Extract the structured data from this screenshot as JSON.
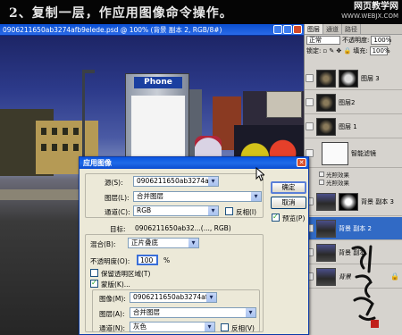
{
  "banner": {
    "instruction": "2、复制一层，作应用图像命令操作。",
    "site_name": "网页教学网",
    "site_url": "WWW.WEBJX.COM"
  },
  "document": {
    "title": "0906211650ab3274afb9elede.psd @ 100% (背景 副本 2, RGB/8#)",
    "booth_sign": "Phone"
  },
  "layers_panel": {
    "tabs": [
      "图层",
      "通道",
      "路径"
    ],
    "blend_mode": "正常",
    "opacity_label": "不透明度:",
    "opacity_value": "100%",
    "lock_label": "锁定:",
    "fill_label": "填充:",
    "fill_value": "100%",
    "layers": [
      {
        "name": "图层 3",
        "visible": true,
        "active": false
      },
      {
        "name": "图层2",
        "visible": true,
        "active": false
      },
      {
        "name": "图层 1",
        "visible": true,
        "active": false
      },
      {
        "name": "智能滤镜",
        "visible": true,
        "active": false
      },
      {
        "name": "背景 副本 3",
        "visible": true,
        "active": false
      },
      {
        "name": "背景 副本 2",
        "visible": true,
        "active": true
      },
      {
        "name": "背景 副本",
        "visible": true,
        "active": false
      },
      {
        "name": "背景",
        "visible": true,
        "active": false
      }
    ],
    "effects": [
      "光照效果",
      "光照效果"
    ]
  },
  "dialog": {
    "title": "应用图像",
    "source_label": "源(S):",
    "source_value": "0906211650ab3274afb9...",
    "layer_label": "图层(L):",
    "layer_value": "合并图层",
    "channel_label": "通道(C):",
    "channel_value": "RGB",
    "invert_label": "反相(I)",
    "target_label": "目标:",
    "target_value": "0906211650ab32...(..., RGB)",
    "blending_label": "混合(B):",
    "blending_value": "正片叠底",
    "opacity_label": "不透明度(O):",
    "opacity_value": "100",
    "opacity_unit": "%",
    "preserve_transparency_label": "保留透明区域(T)",
    "preserve_transparency_checked": false,
    "mask_label": "蒙版(K)...",
    "mask_checked": true,
    "mask_image_label": "图像(M):",
    "mask_image_value": "0906211650ab3274afb9...",
    "mask_layer_label": "图层(A):",
    "mask_layer_value": "合并图层",
    "mask_channel_label": "通道(N):",
    "mask_channel_value": "灰色",
    "mask_invert_label": "反相(V)",
    "ok_label": "确定",
    "cancel_label": "取消",
    "preview_label": "预览(P)",
    "preview_checked": true
  },
  "colors": {
    "title_bar": "#0a55e0",
    "dialog_bg": "#ece9d8",
    "panel_bg": "#d6d3ce",
    "active_layer": "#316ac5"
  }
}
